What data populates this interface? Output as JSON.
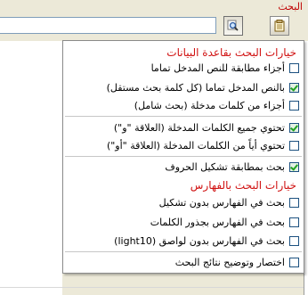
{
  "panel": {
    "title": "البحث"
  },
  "search": {
    "value": ""
  },
  "menu": {
    "database_options_title": "خيارات البحث بقاعدة البيانات",
    "index_options_title": "خيارات البحث بالفهارس",
    "items": [
      {
        "label": "أجزاء مطابقة للنص المدخل تماما",
        "checked": false
      },
      {
        "label": "بالنص المدخل تماما (كل كلمة بحث مستقل)",
        "checked": true
      },
      {
        "label": "أجزاء من كلمات مدخلة (بحث شامل)",
        "checked": false
      },
      {
        "label": "تحتوي جميع الكلمات المدخلة (العلاقة \"و\")",
        "checked": true
      },
      {
        "label": "تحتوي أياً من الكلمات المدخلة (العلاقة \"أو\")",
        "checked": false
      },
      {
        "label": "بحث بمطابقة تشكيل الحروف",
        "checked": true
      },
      {
        "label": "بحث في الفهارس بدون تشكيل",
        "checked": false
      },
      {
        "label": "بحث في الفهارس بجذور الكلمات",
        "checked": false
      },
      {
        "label": "بحث في الفهارس بدون لواصق (light10)",
        "checked": false
      },
      {
        "label": "اختصار وتوضيح نتائج البحث",
        "checked": false
      }
    ]
  },
  "colors": {
    "section_title": "#d01010",
    "check": "#21a121"
  }
}
